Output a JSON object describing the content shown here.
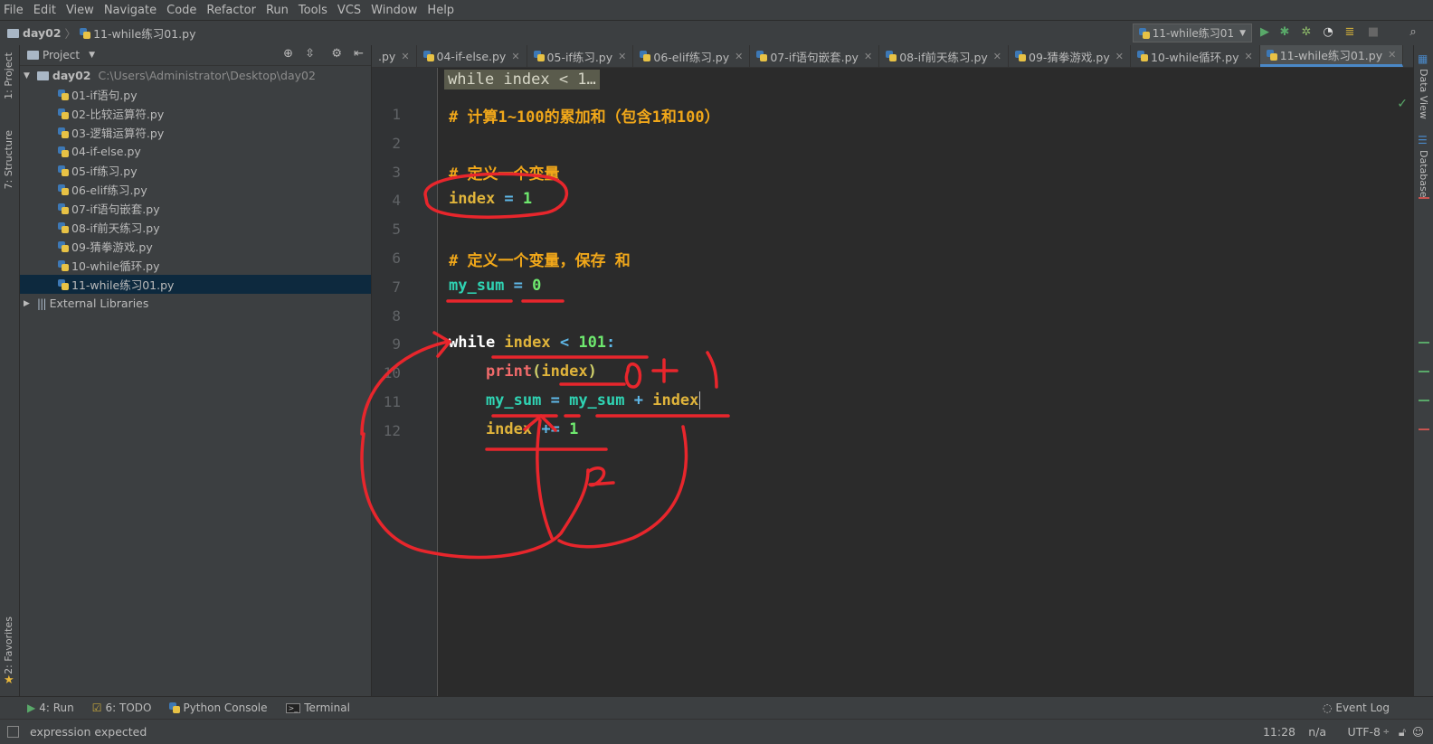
{
  "menu": [
    "File",
    "Edit",
    "View",
    "Navigate",
    "Code",
    "Refactor",
    "Run",
    "Tools",
    "VCS",
    "Window",
    "Help"
  ],
  "breadcrumb": {
    "project": "day02",
    "file": "11-while练习01.py"
  },
  "run_config": "11-while练习01",
  "project_panel": {
    "title": "Project",
    "root": {
      "name": "day02",
      "path": "C:\\Users\\Administrator\\Desktop\\day02"
    },
    "files": [
      "01-if语句.py",
      "02-比较运算符.py",
      "03-逻辑运算符.py",
      "04-if-else.py",
      "05-if练习.py",
      "06-elif练习.py",
      "07-if语句嵌套.py",
      "08-if前天练习.py",
      "09-猜拳游戏.py",
      "10-while循环.py",
      "11-while练习01.py"
    ],
    "selected_index": 10,
    "external": "External Libraries"
  },
  "tabs": [
    ".py",
    "04-if-else.py",
    "05-if练习.py",
    "06-elif练习.py",
    "07-if语句嵌套.py",
    "08-if前天练习.py",
    "09-猜拳游戏.py",
    "10-while循环.py",
    "11-while练习01.py"
  ],
  "sticky_header": "while index < 1…",
  "code": {
    "l1": "# 计算1~100的累加和（包含1和100）",
    "l3": "# 定义一个变量",
    "l4a": "index",
    "l4b": " = ",
    "l4c": "1",
    "l6": "# 定义一个变量，保存 和",
    "l7a": "my_sum",
    "l7b": " = ",
    "l7c": "0",
    "l9a": "while ",
    "l9b": "index",
    "l9c": " < ",
    "l9d": "101",
    ":": ":",
    "l10a": "    print",
    "l10b": "(",
    "l10c": "index",
    "l10d": ")",
    "l11a": "    my_sum",
    "l11b": " = ",
    "l11c": "my_sum",
    "l11d": " + ",
    "l11e": "index",
    "l12a": "    index",
    "l12b": " += ",
    "l12c": "1"
  },
  "line_numbers": [
    "1",
    "2",
    "3",
    "4",
    "5",
    "6",
    "7",
    "8",
    "9",
    "10",
    "11",
    "12"
  ],
  "left_tabs": {
    "project": "1: Project",
    "structure": "7: Structure",
    "favorites": "2: Favorites"
  },
  "right_tabs": {
    "dataview": "Data View",
    "database": "Database"
  },
  "bottom_tools": [
    {
      "label": "4: Run"
    },
    {
      "label": "6: TODO"
    },
    {
      "label": "Python Console"
    },
    {
      "label": "Terminal"
    }
  ],
  "event_log": "Event Log",
  "status": {
    "message": "expression expected",
    "position": "11:28",
    "na": "n/a",
    "encoding": "UTF-8"
  },
  "colors": {
    "accent": "#4a88c7",
    "ink": "#e8262c"
  }
}
